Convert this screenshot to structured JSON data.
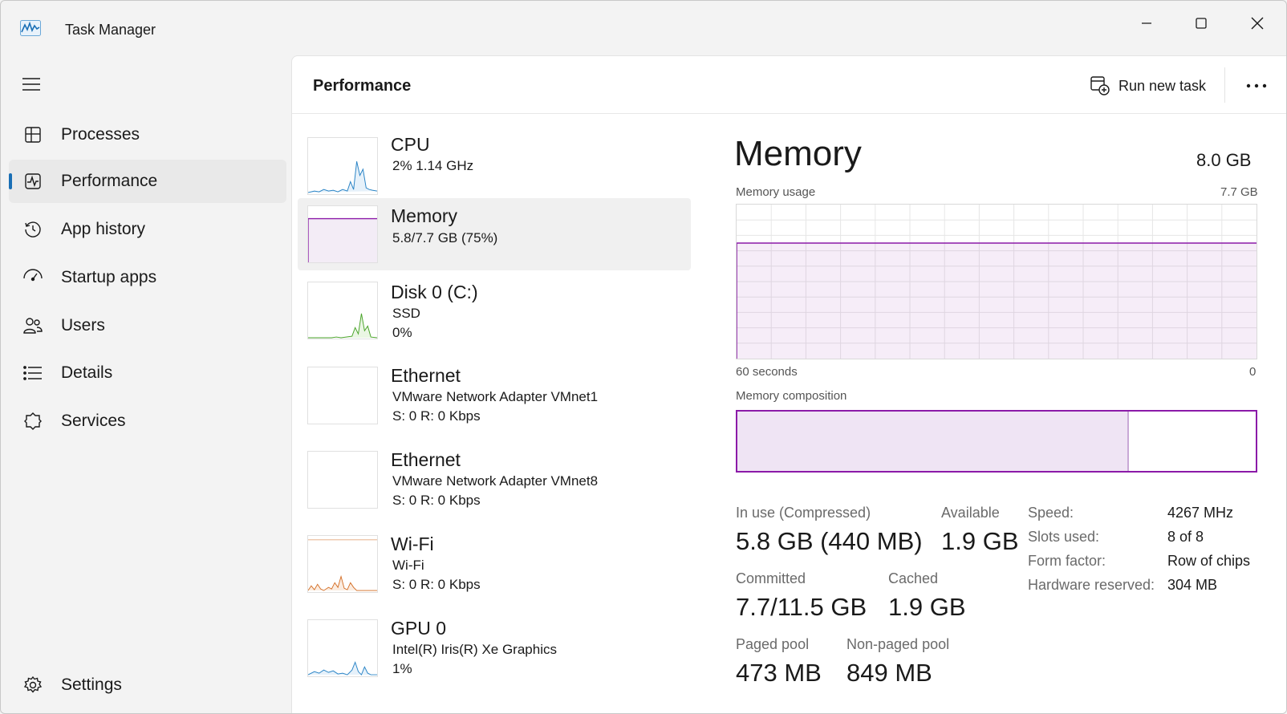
{
  "window": {
    "title": "Task Manager",
    "accent_color": "#1a6fb5",
    "memory_color": "#8b1aa8"
  },
  "sidebar": {
    "items": [
      {
        "label": "Processes",
        "icon": "processes-icon"
      },
      {
        "label": "Performance",
        "icon": "performance-icon",
        "active": true
      },
      {
        "label": "App history",
        "icon": "history-icon"
      },
      {
        "label": "Startup apps",
        "icon": "startup-icon"
      },
      {
        "label": "Users",
        "icon": "users-icon"
      },
      {
        "label": "Details",
        "icon": "details-icon"
      },
      {
        "label": "Services",
        "icon": "services-icon"
      }
    ],
    "settings_label": "Settings"
  },
  "header": {
    "title": "Performance",
    "run_task_label": "Run new task"
  },
  "resources": [
    {
      "name": "CPU",
      "sub1": "2%  1.14 GHz",
      "sub2": ""
    },
    {
      "name": "Memory",
      "sub1": "5.8/7.7 GB (75%)",
      "sub2": "",
      "selected": true
    },
    {
      "name": "Disk 0 (C:)",
      "sub1": "SSD",
      "sub2": "0%"
    },
    {
      "name": "Ethernet",
      "sub1": "VMware Network Adapter VMnet1",
      "sub2": "S: 0  R: 0 Kbps"
    },
    {
      "name": "Ethernet",
      "sub1": "VMware Network Adapter VMnet8",
      "sub2": "S: 0  R: 0 Kbps"
    },
    {
      "name": "Wi-Fi",
      "sub1": "Wi-Fi",
      "sub2": "S: 0  R: 0 Kbps"
    },
    {
      "name": "GPU 0",
      "sub1": "Intel(R) Iris(R) Xe Graphics",
      "sub2": "1%"
    }
  ],
  "detail": {
    "title": "Memory",
    "total": "8.0 GB",
    "usage_label": "Memory usage",
    "usage_max": "7.7 GB",
    "time_left": "60 seconds",
    "time_right": "0",
    "composition_label": "Memory composition",
    "usage_fraction": 0.75,
    "composition_in_use_fraction": 0.755,
    "stats": {
      "in_use_label": "In use (Compressed)",
      "in_use_value": "5.8 GB (440 MB)",
      "available_label": "Available",
      "available_value": "1.9 GB",
      "committed_label": "Committed",
      "committed_value": "7.7/11.5 GB",
      "cached_label": "Cached",
      "cached_value": "1.9 GB",
      "paged_label": "Paged pool",
      "paged_value": "473 MB",
      "nonpaged_label": "Non-paged pool",
      "nonpaged_value": "849 MB"
    },
    "specs": {
      "speed_label": "Speed:",
      "speed_value": "4267 MHz",
      "slots_label": "Slots used:",
      "slots_value": "8 of 8",
      "form_label": "Form factor:",
      "form_value": "Row of chips",
      "hw_label": "Hardware reserved:",
      "hw_value": "304 MB"
    }
  }
}
